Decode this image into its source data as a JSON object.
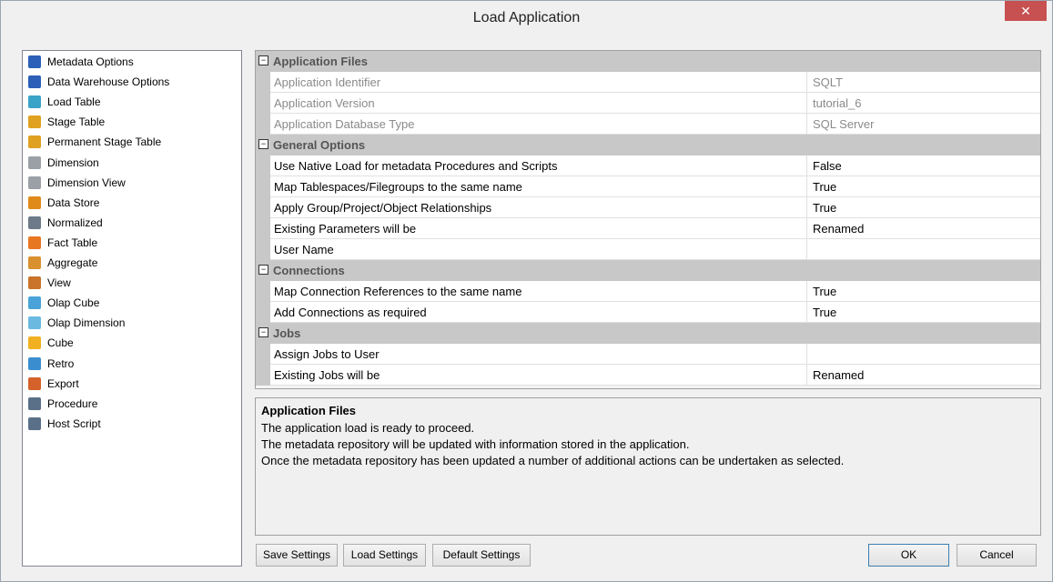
{
  "window": {
    "title": "Load Application",
    "close_glyph": "✕"
  },
  "tree": {
    "items": [
      {
        "label": "Metadata Options",
        "icon": "metadata-options-icon",
        "color": "#2b5fb8"
      },
      {
        "label": "Data Warehouse Options",
        "icon": "data-warehouse-options-icon",
        "color": "#2b5fb8"
      },
      {
        "label": "Load Table",
        "icon": "load-table-icon",
        "color": "#3aa3c7"
      },
      {
        "label": "Stage Table",
        "icon": "stage-table-icon",
        "color": "#e0a020"
      },
      {
        "label": "Permanent Stage Table",
        "icon": "permanent-stage-table-icon",
        "color": "#e0a020"
      },
      {
        "label": "Dimension",
        "icon": "dimension-icon",
        "color": "#9aa0a6"
      },
      {
        "label": "Dimension View",
        "icon": "dimension-view-icon",
        "color": "#9aa0a6"
      },
      {
        "label": "Data Store",
        "icon": "data-store-icon",
        "color": "#e08a1a"
      },
      {
        "label": "Normalized",
        "icon": "normalized-icon",
        "color": "#6c7a89"
      },
      {
        "label": "Fact Table",
        "icon": "fact-table-icon",
        "color": "#e87722"
      },
      {
        "label": "Aggregate",
        "icon": "aggregate-icon",
        "color": "#d9902f"
      },
      {
        "label": "View",
        "icon": "view-icon",
        "color": "#c9742a"
      },
      {
        "label": "Olap Cube",
        "icon": "olap-cube-icon",
        "color": "#4aa3d8"
      },
      {
        "label": "Olap Dimension",
        "icon": "olap-dimension-icon",
        "color": "#6bb9e0"
      },
      {
        "label": "Cube",
        "icon": "cube-icon",
        "color": "#f0b020"
      },
      {
        "label": "Retro",
        "icon": "retro-icon",
        "color": "#3a8ed0"
      },
      {
        "label": "Export",
        "icon": "export-icon",
        "color": "#d4622a"
      },
      {
        "label": "Procedure",
        "icon": "procedure-icon",
        "color": "#5a6f88"
      },
      {
        "label": "Host Script",
        "icon": "host-script-icon",
        "color": "#5a6f88"
      }
    ]
  },
  "grid": {
    "collapse_glyph": "−",
    "categories": [
      {
        "label": "Application Files",
        "props": [
          {
            "name": "Application Identifier",
            "value": "SQLT",
            "readonly": true
          },
          {
            "name": "Application Version",
            "value": "tutorial_6",
            "readonly": true
          },
          {
            "name": "Application Database Type",
            "value": "SQL Server",
            "readonly": true
          }
        ]
      },
      {
        "label": "General Options",
        "props": [
          {
            "name": "Use Native Load for metadata Procedures and Scripts",
            "value": "False",
            "readonly": false
          },
          {
            "name": "Map Tablespaces/Filegroups to the same name",
            "value": "True",
            "readonly": false
          },
          {
            "name": "Apply Group/Project/Object Relationships",
            "value": "True",
            "readonly": false
          },
          {
            "name": "Existing Parameters will be",
            "value": "Renamed",
            "readonly": false
          },
          {
            "name": "User Name",
            "value": "",
            "readonly": false
          }
        ]
      },
      {
        "label": "Connections",
        "props": [
          {
            "name": "Map Connection References to the same name",
            "value": "True",
            "readonly": false
          },
          {
            "name": "Add Connections as required",
            "value": "True",
            "readonly": false
          }
        ]
      },
      {
        "label": "Jobs",
        "props": [
          {
            "name": "Assign Jobs to User",
            "value": "",
            "readonly": false
          },
          {
            "name": "Existing Jobs will be",
            "value": "Renamed",
            "readonly": false
          }
        ]
      }
    ]
  },
  "description": {
    "title": "Application Files",
    "lines": [
      "The application load is ready to proceed.",
      "The metadata repository will be updated with information stored in the application.",
      "Once the metadata repository has been updated a number of additional actions can be undertaken as selected."
    ]
  },
  "buttons": {
    "save_settings": "Save Settings",
    "load_settings": "Load Settings",
    "default_settings": "Default Settings",
    "ok": "OK",
    "cancel": "Cancel"
  }
}
